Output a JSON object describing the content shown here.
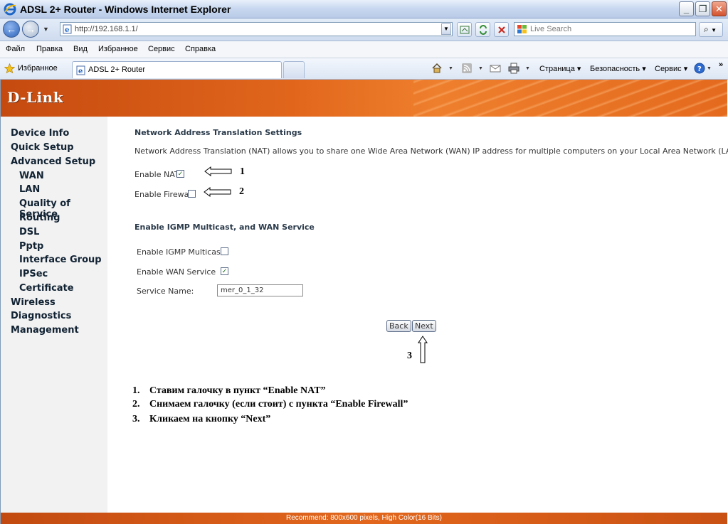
{
  "window": {
    "title": "ADSL 2+ Router - Windows Internet Explorer",
    "minimize": "_",
    "maximize": "❐",
    "close": "✕"
  },
  "address": {
    "url": "http://192.168.1.1/",
    "search_placeholder": "Live Search"
  },
  "menu": [
    "Файл",
    "Правка",
    "Вид",
    "Избранное",
    "Сервис",
    "Справка"
  ],
  "favbar": {
    "favorites_label": "Избранное",
    "tab_label": "ADSL 2+ Router",
    "page_menu": "Страница ▾",
    "security_menu": "Безопасность ▾",
    "tools_menu": "Сервис ▾",
    "more": "»"
  },
  "brand": {
    "logo": "D-Link"
  },
  "sidebar": {
    "items": [
      {
        "label": "Device Info"
      },
      {
        "label": "Quick Setup"
      },
      {
        "label": "Advanced Setup"
      },
      {
        "label": "WAN"
      },
      {
        "label": "LAN"
      },
      {
        "label": "Quality of Service"
      },
      {
        "label": "Routing"
      },
      {
        "label": "DSL"
      },
      {
        "label": "Pptp"
      },
      {
        "label": "Interface Group"
      },
      {
        "label": "IPSec"
      },
      {
        "label": "Certificate"
      },
      {
        "label": "Wireless"
      },
      {
        "label": "Diagnostics"
      },
      {
        "label": "Management"
      }
    ]
  },
  "nat": {
    "heading": "Network Address Translation Settings",
    "description": "Network Address Translation (NAT) allows you to share one Wide Area Network (WAN) IP address for multiple computers on your Local Area Network (LAN).",
    "enable_nat_label": "Enable NAT",
    "enable_nat_checked": true,
    "enable_firewall_label": "Enable Firewall",
    "enable_firewall_checked": false
  },
  "igmp": {
    "heading": "Enable IGMP Multicast, and WAN Service",
    "igmp_label": "Enable IGMP Multicast",
    "igmp_checked": false,
    "wan_label": "Enable WAN Service",
    "wan_checked": true,
    "service_name_label": "Service Name:",
    "service_name_value": "mer_0_1_32"
  },
  "buttons": {
    "back": "Back",
    "next": "Next"
  },
  "annotations": {
    "n1": "1",
    "n2": "2",
    "n3": "3",
    "instructions": [
      {
        "num": "1.",
        "text": "Ставим галочку в пункт “Enable NAT”"
      },
      {
        "num": "2.",
        "text": "Снимаем галочку (если стоит) с пункта “Enable Firewall”"
      },
      {
        "num": "3.",
        "text": "Кликаем на кнопку “Next”"
      }
    ]
  },
  "footer": {
    "text": "Recommend: 800x600 pixels, High Color(16 Bits)"
  },
  "colors": {
    "brand_orange": "#e1661c",
    "sidebar_bg": "#f2f2f2",
    "checkmark": "#1a6a1a"
  }
}
